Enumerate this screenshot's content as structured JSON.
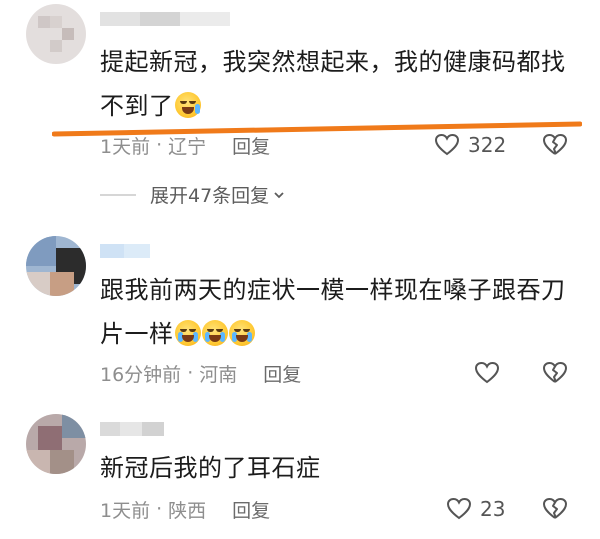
{
  "comments": [
    {
      "text": "提起新冠，我突然想起来，我的健康码都找不到了",
      "time": "1天前",
      "location": "辽宁",
      "reply_label": "回复",
      "likes": "322",
      "emojis": [
        "grin-sweat-emoji"
      ]
    },
    {
      "text": "跟我前两天的症状一模一样现在嗓子跟吞刀片一样",
      "time": "16分钟前",
      "location": "河南",
      "reply_label": "回复",
      "likes": "",
      "emojis": [
        "crying-emoji",
        "crying-emoji",
        "crying-emoji"
      ]
    },
    {
      "text": "新冠后我的了耳石症",
      "time": "1天前",
      "location": "陕西",
      "reply_label": "回复",
      "likes": "23",
      "emojis": []
    }
  ],
  "expand_replies": "展开47条回复",
  "colors": {
    "accent_underline": "#f07a1a",
    "meta": "#8e8e8e"
  }
}
